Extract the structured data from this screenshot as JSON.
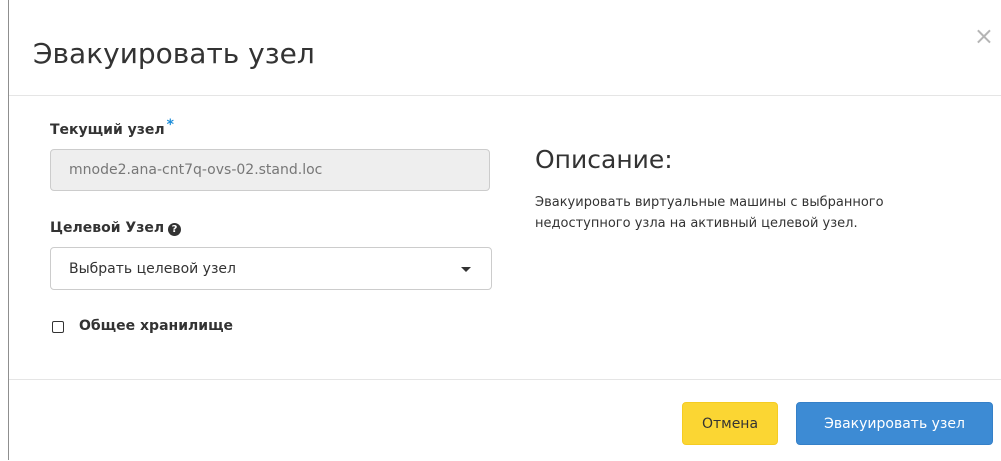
{
  "dialog": {
    "title": "Эвакуировать узел",
    "close_icon": "close-icon",
    "close_glyph": "×"
  },
  "form": {
    "current_node": {
      "label": "Текущий узел",
      "required_mark": "*",
      "value": "mnode2.ana-cnt7q-ovs-02.stand.loc"
    },
    "target_node": {
      "label": "Целевой Узел",
      "help_icon": "question-circle-icon",
      "help_glyph": "?",
      "selected": "Выбрать целевой узел"
    },
    "shared_storage": {
      "label": "Общее хранилище",
      "checked": false
    }
  },
  "description": {
    "title": "Описание:",
    "text": "Эвакуировать виртуальные машины с выбранного недоступного узла на активный целевой узел."
  },
  "footer": {
    "cancel_label": "Отмена",
    "submit_label": "Эвакуировать узел"
  },
  "colors": {
    "cancel": "#fbd633",
    "primary": "#3d8bd4",
    "required": "#1a8cd9"
  }
}
